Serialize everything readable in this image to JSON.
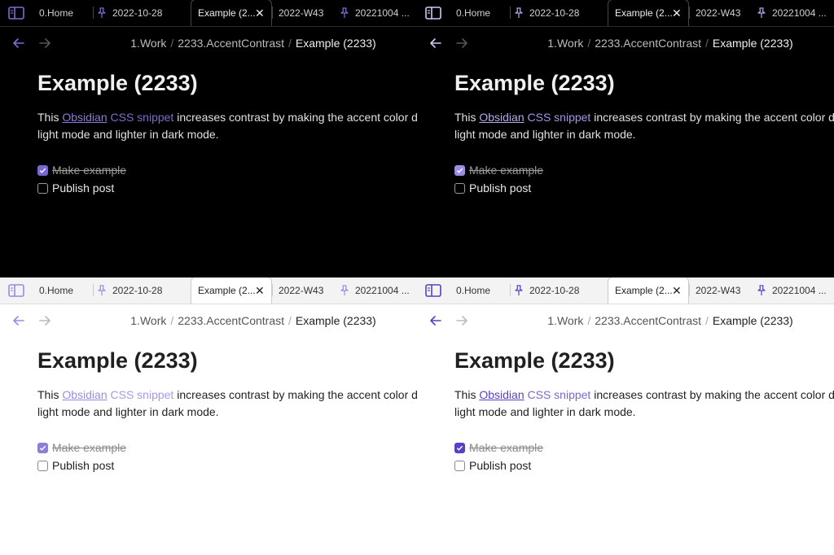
{
  "tabs": {
    "home": "0.Home",
    "date": "2022-10-28",
    "active": "Example (2...",
    "week": "2022-W43",
    "last": "20221004 ..."
  },
  "icons": {
    "sidebar": "sidebar-toggle-icon",
    "pin": "pin-icon",
    "close": "close-icon",
    "back": "arrow-left-icon",
    "forward": "arrow-right-icon"
  },
  "breadcrumb": {
    "crumb1": "1.Work",
    "crumb2": "2233.AccentContrast",
    "current": "Example (2233)",
    "separator": "/"
  },
  "note": {
    "title": "Example (2233)",
    "intro": "This",
    "link_obsidian": "Obsidian",
    "link_css": "CSS snippet",
    "rest_line1": " increases contrast by making the accent color d",
    "line2": "light mode and lighter in dark mode."
  },
  "tasks": [
    {
      "label": "Make example",
      "done": true
    },
    {
      "label": "Publish post",
      "done": false
    }
  ],
  "colors": {
    "accent": "#7c62d8",
    "dark_bg": "#000000",
    "light_bg": "#ffffff"
  }
}
